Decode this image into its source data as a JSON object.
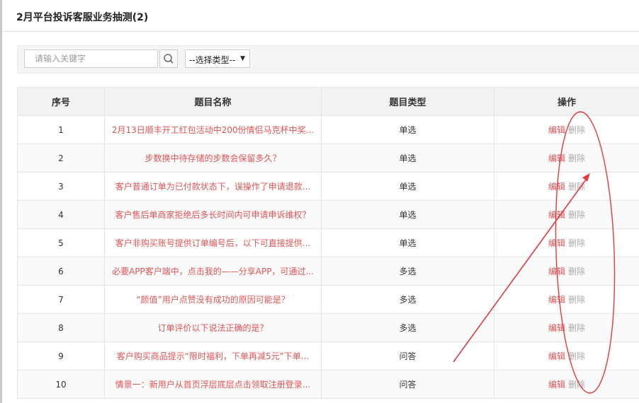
{
  "header": {
    "title": "2月平台投诉客服业务抽测(2)"
  },
  "toolbar": {
    "search_placeholder": "请输入关键字",
    "search_icon": "search-icon",
    "type_select_value": "--选择类型--"
  },
  "table": {
    "columns": [
      "序号",
      "题目名称",
      "题目类型",
      "操作"
    ],
    "action_edit": "编辑",
    "action_delete": "删除",
    "rows": [
      {
        "no": "1",
        "name": "2月13日顺丰开工红包活动中200份情侣马克杯中奖...",
        "type": "单选"
      },
      {
        "no": "2",
        "name": "步数换中待存储的步数会保留多久？",
        "type": "单选"
      },
      {
        "no": "3",
        "name": "客户普通订单为已付款状态下，误操作了申请退款...",
        "type": "单选"
      },
      {
        "no": "4",
        "name": "客户售后单商家拒绝后多长时间内可申请申诉维权？",
        "type": "单选"
      },
      {
        "no": "5",
        "name": "客户非购买账号提供订单编号后，以下可直接提供...",
        "type": "单选"
      },
      {
        "no": "6",
        "name": "必要APP客户端中，点击我的——分享APP，可通过...",
        "type": "多选"
      },
      {
        "no": "7",
        "name": "“颜值”用户点赞没有成功的原因可能是？",
        "type": "多选"
      },
      {
        "no": "8",
        "name": "订单评价以下说法正确的是？",
        "type": "多选"
      },
      {
        "no": "9",
        "name": "客户购买商品提示“限时福利，下单再减5元”下单...",
        "type": "问答"
      },
      {
        "no": "10",
        "name": "情景一：新用户从首页浮层底层点击领取注册登录...",
        "type": "问答"
      }
    ]
  },
  "annotation": {
    "color": "#e8383d"
  }
}
